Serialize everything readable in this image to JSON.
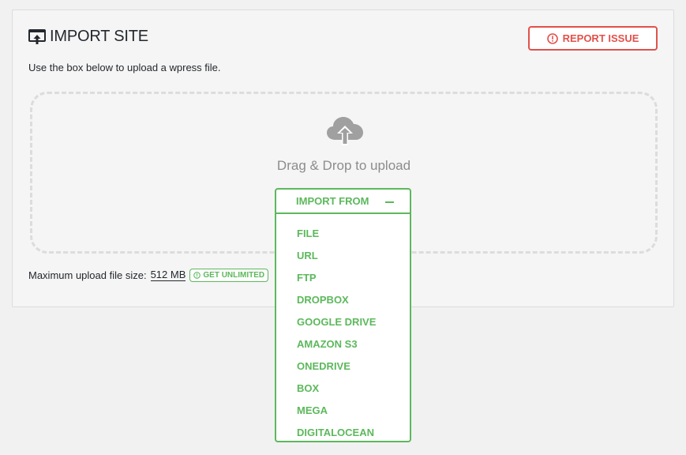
{
  "header": {
    "title": "IMPORT SITE",
    "report_label": "REPORT ISSUE"
  },
  "description": "Use the box below to upload a wpress file.",
  "dropzone": {
    "text": "Drag & Drop to upload"
  },
  "limit": {
    "label": "Maximum upload file size:",
    "size": "512 MB",
    "unlimited_label": "GET UNLIMITED"
  },
  "import_menu": {
    "label": "IMPORT FROM",
    "items": [
      "FILE",
      "URL",
      "FTP",
      "DROPBOX",
      "GOOGLE DRIVE",
      "AMAZON S3",
      "ONEDRIVE",
      "BOX",
      "MEGA",
      "DIGITALOCEAN"
    ]
  },
  "colors": {
    "accent_green": "#5cb85c",
    "report_red": "#e2514b",
    "muted_text": "#8c8c8c"
  }
}
